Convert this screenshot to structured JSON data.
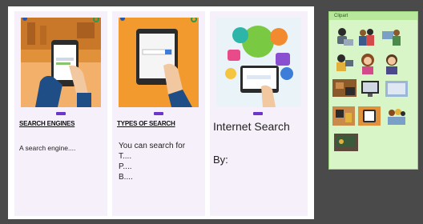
{
  "cards": [
    {
      "title": "SEARCH ENGINES",
      "body": "A search engine....",
      "image_icon": "phone-search-illustration-icon"
    },
    {
      "title": "TYPES OF SEARCH",
      "lines": [
        "You can search for",
        "T....",
        "P....",
        "B...."
      ],
      "image_icon": "tablet-search-illustration-icon"
    },
    {
      "title": "Internet Search",
      "by_label": "By:",
      "image_icon": "cloud-apps-illustration-icon"
    }
  ],
  "clipart_panel": {
    "header": "Clipart",
    "items": [
      "person-laptop-clip-icon",
      "people-group-clip-icon",
      "computer-users-clip-icon",
      "person-computer-clip-icon",
      "girl-avatar-clip-icon",
      "boy-avatar-clip-icon",
      "desk-photo-clip-icon",
      "monitor-clip-icon",
      "screen-clip-icon",
      "classroom-clip-icon",
      "tablet-clip-icon",
      "kids-group-clip-icon",
      "chalkboard-clip-icon"
    ]
  },
  "colors": {
    "background": "#4a4a4a",
    "board": "#ffffff",
    "card": "#f6f0fa",
    "tab_accent": "#6b36c9",
    "clip_panel": "#d7f5c7"
  }
}
